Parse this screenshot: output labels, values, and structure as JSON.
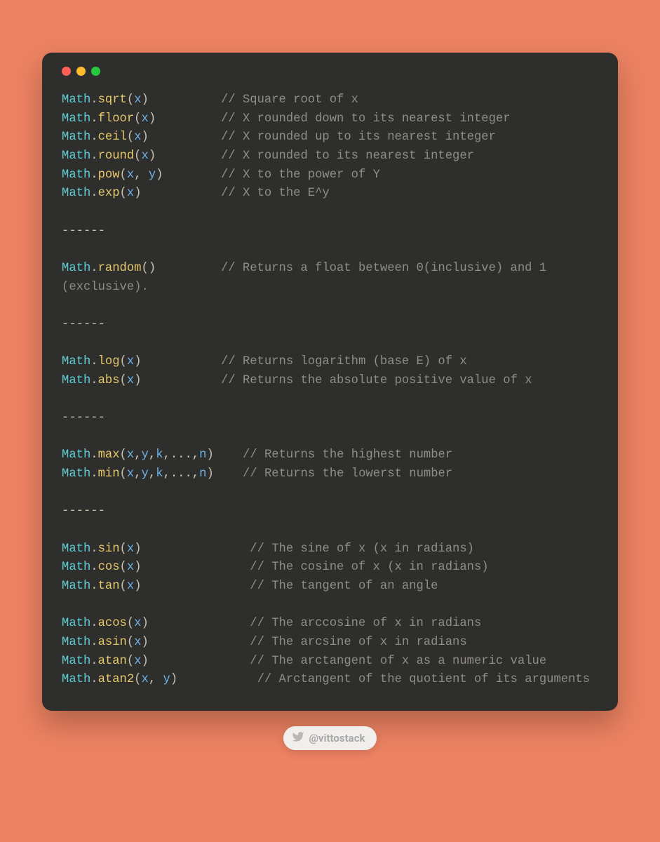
{
  "colors": {
    "bg": "#ec8262",
    "window": "#2e2e2d",
    "object": "#5dd0d6",
    "function": "#e8c96a",
    "variable": "#6eb2e4",
    "comment": "#8f8d85",
    "default": "#cfc9b8"
  },
  "win": {
    "dots": [
      "#ff5f56",
      "#ffbd2e",
      "#27c93f"
    ]
  },
  "lines": [
    {
      "type": "call",
      "obj": "Math",
      "fn": "sqrt",
      "args": [
        "x"
      ],
      "pad": 10,
      "comment": "Square root of x"
    },
    {
      "type": "call",
      "obj": "Math",
      "fn": "floor",
      "args": [
        "x"
      ],
      "pad": 9,
      "comment": "X rounded down to its nearest integer"
    },
    {
      "type": "call",
      "obj": "Math",
      "fn": "ceil",
      "args": [
        "x"
      ],
      "pad": 10,
      "comment": "X rounded up to its nearest integer"
    },
    {
      "type": "call",
      "obj": "Math",
      "fn": "round",
      "args": [
        "x"
      ],
      "pad": 9,
      "comment": "X rounded to its nearest integer"
    },
    {
      "type": "call",
      "obj": "Math",
      "fn": "pow",
      "args": [
        "x",
        "y"
      ],
      "pad": 8,
      "comment": "X to the power of Y"
    },
    {
      "type": "call",
      "obj": "Math",
      "fn": "exp",
      "args": [
        "x"
      ],
      "pad": 11,
      "comment": "X to the E^y"
    },
    {
      "type": "blank"
    },
    {
      "type": "sep",
      "text": "------"
    },
    {
      "type": "blank"
    },
    {
      "type": "call",
      "obj": "Math",
      "fn": "random",
      "args": [],
      "pad": 9,
      "comment": "Returns a float between 0(inclusive) and 1 (exclusive)."
    },
    {
      "type": "blank"
    },
    {
      "type": "sep",
      "text": "------"
    },
    {
      "type": "blank"
    },
    {
      "type": "call",
      "obj": "Math",
      "fn": "log",
      "args": [
        "x"
      ],
      "pad": 11,
      "comment": "Returns logarithm (base E) of x"
    },
    {
      "type": "call",
      "obj": "Math",
      "fn": "abs",
      "args": [
        "x"
      ],
      "pad": 11,
      "comment": "Returns the absolute positive value of x"
    },
    {
      "type": "blank"
    },
    {
      "type": "sep",
      "text": "------"
    },
    {
      "type": "blank"
    },
    {
      "type": "call",
      "obj": "Math",
      "fn": "max",
      "args": [
        "x",
        "y",
        "k",
        "...",
        "n"
      ],
      "pad": 4,
      "comment": "Returns the highest number"
    },
    {
      "type": "call",
      "obj": "Math",
      "fn": "min",
      "args": [
        "x",
        "y",
        "k",
        "...",
        "n"
      ],
      "pad": 4,
      "comment": "Returns the lowerst number"
    },
    {
      "type": "blank"
    },
    {
      "type": "sep",
      "text": "------"
    },
    {
      "type": "blank"
    },
    {
      "type": "call",
      "obj": "Math",
      "fn": "sin",
      "args": [
        "x"
      ],
      "pad": 15,
      "comment": "The sine of x (x in radians)"
    },
    {
      "type": "call",
      "obj": "Math",
      "fn": "cos",
      "args": [
        "x"
      ],
      "pad": 15,
      "comment": "The cosine of x (x in radians)"
    },
    {
      "type": "call",
      "obj": "Math",
      "fn": "tan",
      "args": [
        "x"
      ],
      "pad": 15,
      "comment": "The tangent of an angle"
    },
    {
      "type": "blank"
    },
    {
      "type": "call",
      "obj": "Math",
      "fn": "acos",
      "args": [
        "x"
      ],
      "pad": 14,
      "comment": "The arccosine of x in radians"
    },
    {
      "type": "call",
      "obj": "Math",
      "fn": "asin",
      "args": [
        "x"
      ],
      "pad": 14,
      "comment": "The arcsine of x in radians"
    },
    {
      "type": "call",
      "obj": "Math",
      "fn": "atan",
      "args": [
        "x"
      ],
      "pad": 14,
      "comment": "The arctangent of x as a numeric value"
    },
    {
      "type": "call",
      "obj": "Math",
      "fn": "atan2",
      "args": [
        "x",
        "y"
      ],
      "pad": 11,
      "comment": "Arctangent of the quotient of its arguments"
    }
  ],
  "attribution": {
    "handle": "@vittostack",
    "icon": "twitter-icon"
  }
}
